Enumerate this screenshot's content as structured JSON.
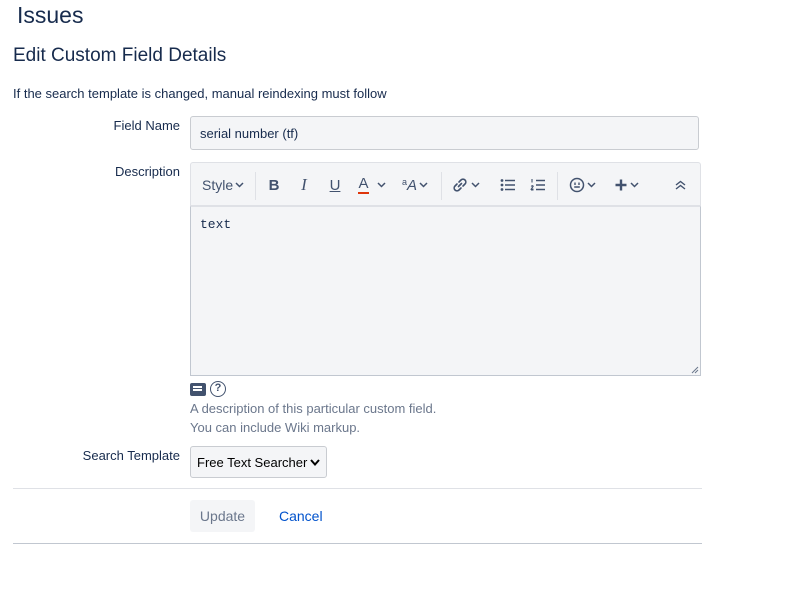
{
  "page": {
    "heading": "Issues"
  },
  "form": {
    "title": "Edit Custom Field Details",
    "note": "If the search template is changed, manual reindexing must follow",
    "field_name": {
      "label": "Field Name",
      "value": "serial number (tf)"
    },
    "description": {
      "label": "Description",
      "value": "text",
      "help_line1": "A description of this particular custom field.",
      "help_line2": "You can include Wiki markup."
    },
    "search_template": {
      "label": "Search Template",
      "selected": "Free Text Searcher",
      "options": [
        "Free Text Searcher"
      ]
    },
    "actions": {
      "update_label": "Update",
      "cancel_label": "Cancel"
    }
  },
  "toolbar": {
    "style_label": "Style",
    "bold": "B",
    "italic": "I",
    "underline": "U",
    "text_color": "A",
    "text_color_accent": "#de350b",
    "more_formatting": "A",
    "more_formatting_prefix": "a",
    "icons": [
      "link-icon",
      "bullet-list-icon",
      "numbered-list-icon",
      "emoji-icon",
      "insert-plus-icon",
      "collapse-icon"
    ]
  }
}
